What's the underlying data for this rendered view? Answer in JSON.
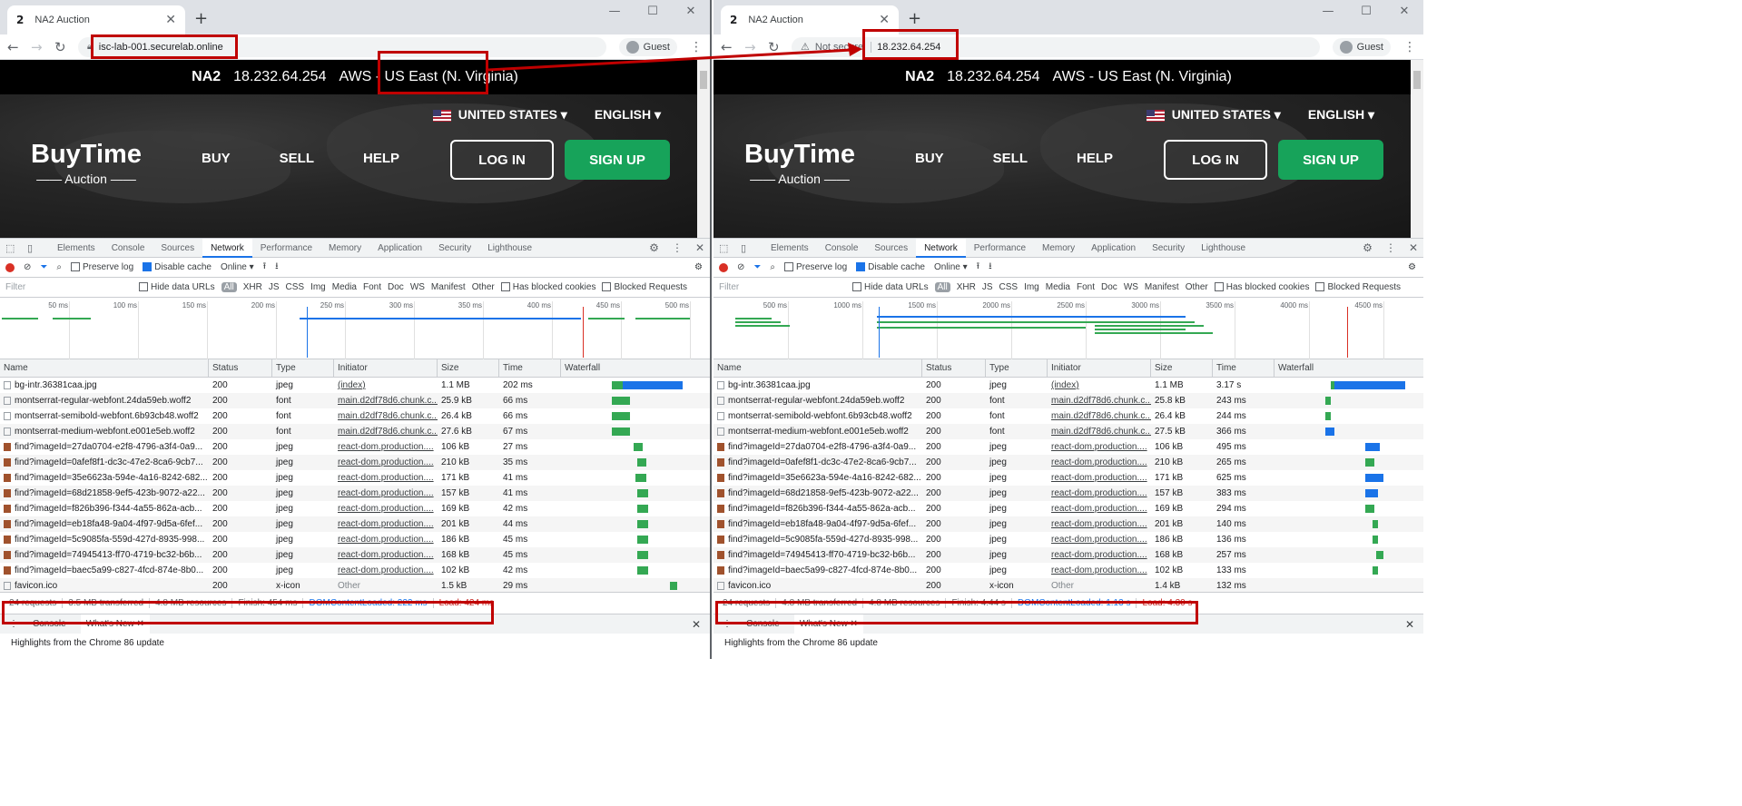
{
  "browser": {
    "tab_count": "2",
    "tab_title": "NA2 Auction",
    "guest_label": "Guest"
  },
  "left": {
    "url": "isc-lab-001.securelab.online"
  },
  "right": {
    "not_secure": "Not secure",
    "url": "18.232.64.254"
  },
  "site": {
    "region_code": "NA2",
    "ip": "18.232.64.254",
    "region_name": "AWS - US East (N. Virginia)",
    "country": "UNITED STATES ▾",
    "language": "ENGLISH ▾",
    "logo_title": "BuyTime",
    "logo_sub": "—— Auction ——",
    "nav": [
      "BUY",
      "SELL",
      "HELP"
    ],
    "login": "LOG IN",
    "signup": "SIGN UP"
  },
  "devtools": {
    "tabs": [
      "Elements",
      "Console",
      "Sources",
      "Network",
      "Performance",
      "Memory",
      "Application",
      "Security",
      "Lighthouse"
    ],
    "preserve_log": "Preserve log",
    "disable_cache": "Disable cache",
    "throttle": "Online",
    "filter_placeholder": "Filter",
    "hide_data_urls": "Hide data URLs",
    "filter_types": [
      "All",
      "XHR",
      "JS",
      "CSS",
      "Img",
      "Media",
      "Font",
      "Doc",
      "WS",
      "Manifest",
      "Other"
    ],
    "blocked_cookies": "Has blocked cookies",
    "blocked_requests": "Blocked Requests",
    "columns": [
      "Name",
      "Status",
      "Type",
      "Initiator",
      "Size",
      "Time",
      "Waterfall"
    ],
    "drawer_tabs": [
      "Console",
      "What's New"
    ],
    "highlights": "Highlights from the Chrome 86 update"
  },
  "left_ticks": [
    "50 ms",
    "100 ms",
    "150 ms",
    "200 ms",
    "250 ms",
    "300 ms",
    "350 ms",
    "400 ms",
    "450 ms",
    "500 ms"
  ],
  "right_ticks": [
    "500 ms",
    "1000 ms",
    "1500 ms",
    "2000 ms",
    "2500 ms",
    "3000 ms",
    "3500 ms",
    "4000 ms",
    "4500 ms"
  ],
  "rows": [
    {
      "name": "bg-intr.36381caa.jpg",
      "status": "200",
      "type": "jpeg",
      "initiator": "(index)",
      "size": "1.1 MB",
      "lt": "202 ms",
      "rt": "3.17 s",
      "rsize": "1.1 MB"
    },
    {
      "name": "montserrat-regular-webfont.24da59eb.woff2",
      "status": "200",
      "type": "font",
      "initiator": "main.d2df78d6.chunk.c...",
      "size": "25.9 kB",
      "lt": "66 ms",
      "rt": "243 ms",
      "rsize": "25.8 kB"
    },
    {
      "name": "montserrat-semibold-webfont.6b93cb48.woff2",
      "status": "200",
      "type": "font",
      "initiator": "main.d2df78d6.chunk.c...",
      "size": "26.4 kB",
      "lt": "66 ms",
      "rt": "244 ms",
      "rsize": "26.4 kB"
    },
    {
      "name": "montserrat-medium-webfont.e001e5eb.woff2",
      "status": "200",
      "type": "font",
      "initiator": "main.d2df78d6.chunk.c...",
      "size": "27.6 kB",
      "lt": "67 ms",
      "rt": "366 ms",
      "rsize": "27.5 kB"
    },
    {
      "name": "find?imageId=27da0704-e2f8-4796-a3f4-0a9...",
      "status": "200",
      "type": "jpeg",
      "initiator": "react-dom.production....",
      "size": "106 kB",
      "lt": "27 ms",
      "rt": "495 ms",
      "rsize": "106 kB"
    },
    {
      "name": "find?imageId=0afef8f1-dc3c-47e2-8ca6-9cb7...",
      "status": "200",
      "type": "jpeg",
      "initiator": "react-dom.production....",
      "size": "210 kB",
      "lt": "35 ms",
      "rt": "265 ms",
      "rsize": "210 kB"
    },
    {
      "name": "find?imageId=35e6623a-594e-4a16-8242-682...",
      "status": "200",
      "type": "jpeg",
      "initiator": "react-dom.production....",
      "size": "171 kB",
      "lt": "41 ms",
      "rt": "625 ms",
      "rsize": "171 kB"
    },
    {
      "name": "find?imageId=68d21858-9ef5-423b-9072-a22...",
      "status": "200",
      "type": "jpeg",
      "initiator": "react-dom.production....",
      "size": "157 kB",
      "lt": "41 ms",
      "rt": "383 ms",
      "rsize": "157 kB"
    },
    {
      "name": "find?imageId=f826b396-f344-4a55-862a-acb...",
      "status": "200",
      "type": "jpeg",
      "initiator": "react-dom.production....",
      "size": "169 kB",
      "lt": "42 ms",
      "rt": "294 ms",
      "rsize": "169 kB"
    },
    {
      "name": "find?imageId=eb18fa48-9a04-4f97-9d5a-6fef...",
      "status": "200",
      "type": "jpeg",
      "initiator": "react-dom.production....",
      "size": "201 kB",
      "lt": "44 ms",
      "rt": "140 ms",
      "rsize": "201 kB"
    },
    {
      "name": "find?imageId=5c9085fa-559d-427d-8935-998...",
      "status": "200",
      "type": "jpeg",
      "initiator": "react-dom.production....",
      "size": "186 kB",
      "lt": "45 ms",
      "rt": "136 ms",
      "rsize": "186 kB"
    },
    {
      "name": "find?imageId=74945413-ff70-4719-bc32-b6b...",
      "status": "200",
      "type": "jpeg",
      "initiator": "react-dom.production....",
      "size": "168 kB",
      "lt": "45 ms",
      "rt": "257 ms",
      "rsize": "168 kB"
    },
    {
      "name": "find?imageId=baec5a99-c827-4fcd-874e-8b0...",
      "status": "200",
      "type": "jpeg",
      "initiator": "react-dom.production....",
      "size": "102 kB",
      "lt": "42 ms",
      "rt": "133 ms",
      "rsize": "102 kB"
    },
    {
      "name": "favicon.ico",
      "status": "200",
      "type": "x-icon",
      "initiator": "Other",
      "size": "1.5 kB",
      "lt": "29 ms",
      "rt": "132 ms",
      "rsize": "1.4 kB"
    }
  ],
  "left_summary": {
    "requests": "24 requests",
    "transferred": "3.5 MB transferred",
    "resources": "4.8 MB resources",
    "finish": "Finish: 454 ms",
    "dcl": "DOMContentLoaded: 222 ms",
    "load": "Load: 424 ms"
  },
  "right_summary": {
    "requests": "24 requests",
    "transferred": "4.8 MB transferred",
    "resources": "4.8 MB resources",
    "finish": "Finish: 4.44 s",
    "dcl": "DOMContentLoaded: 1.13 s",
    "load": "Load: 4.30 s"
  }
}
